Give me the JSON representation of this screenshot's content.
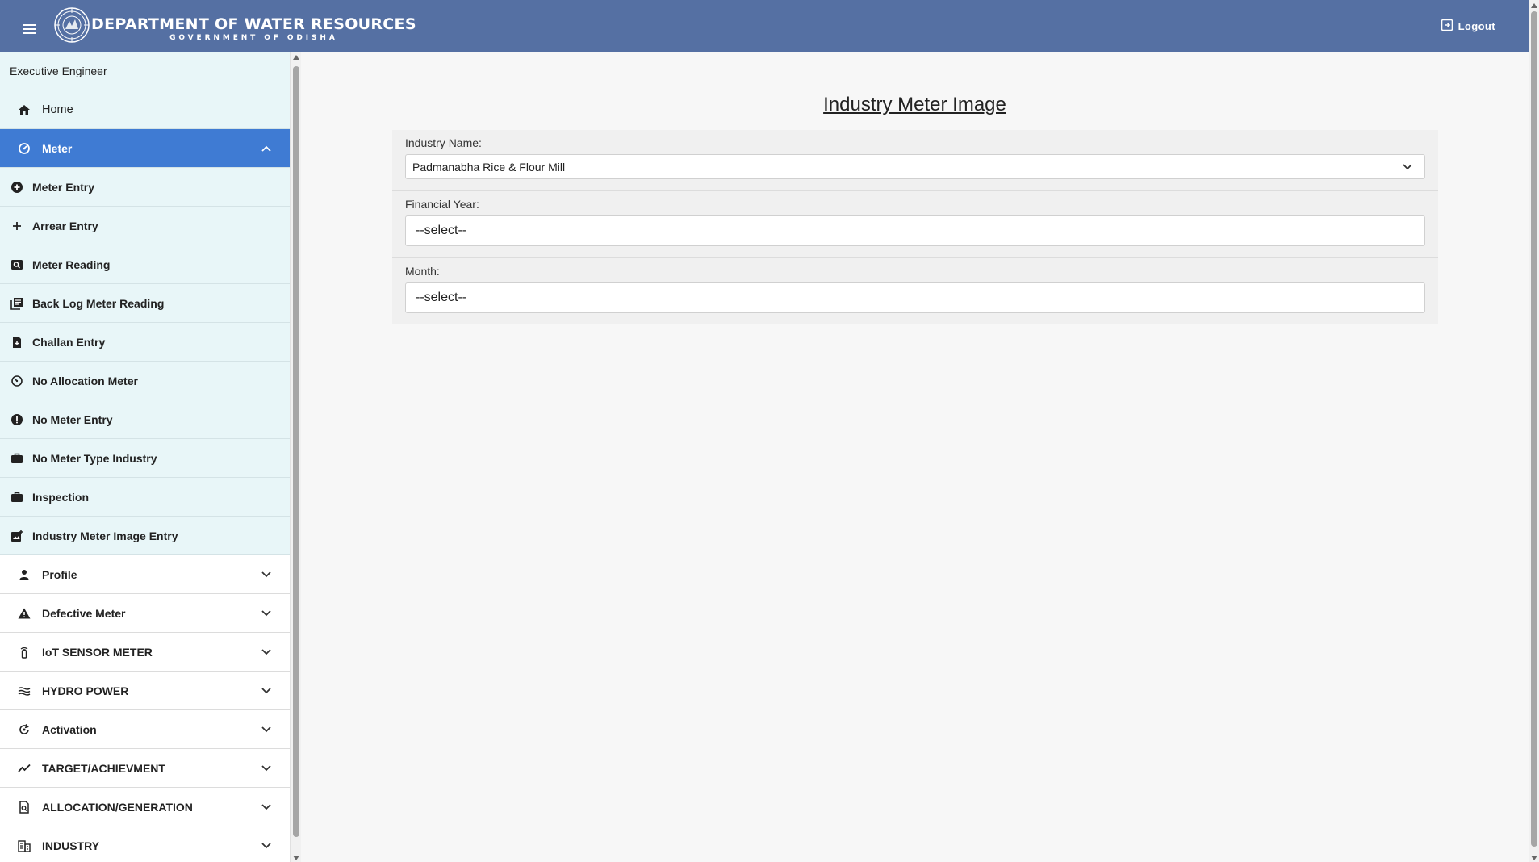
{
  "header": {
    "title": "DEPARTMENT OF WATER RESOURCES",
    "subtitle": "GOVERNMENT OF ODISHA",
    "logout_label": "Logout"
  },
  "sidebar": {
    "user_role": "Executive Engineer",
    "home_label": "Home",
    "active_section": "Meter",
    "sub_items": [
      {
        "label": "Meter Entry",
        "icon": "plus-circle-icon"
      },
      {
        "label": "Arrear Entry",
        "icon": "plus-icon"
      },
      {
        "label": "Meter Reading",
        "icon": "search-reading-icon"
      },
      {
        "label": "Back Log Meter Reading",
        "icon": "library-books-icon"
      },
      {
        "label": "Challan Entry",
        "icon": "document-add-icon"
      },
      {
        "label": "No Allocation Meter",
        "icon": "meter-off-icon"
      },
      {
        "label": "No Meter Entry",
        "icon": "exclamation-circle-icon"
      },
      {
        "label": "No Meter Type Industry",
        "icon": "briefcase-icon"
      },
      {
        "label": "Inspection",
        "icon": "briefcase-icon"
      },
      {
        "label": "Industry Meter Image Entry",
        "icon": "add-photo-icon"
      }
    ],
    "sections": [
      {
        "label": "Profile",
        "icon": "person-icon"
      },
      {
        "label": "Defective Meter",
        "icon": "warning-icon"
      },
      {
        "label": "IoT SENSOR METER",
        "icon": "sensor-icon"
      },
      {
        "label": "HYDRO POWER",
        "icon": "waves-icon"
      },
      {
        "label": "Activation",
        "icon": "refresh-icon"
      },
      {
        "label": "TARGET/ACHIEVMENT",
        "icon": "trending-icon"
      },
      {
        "label": "ALLOCATION/GENERATION",
        "icon": "document-search-icon"
      },
      {
        "label": "INDUSTRY",
        "icon": "building-icon"
      }
    ]
  },
  "main": {
    "title": "Industry Meter Image",
    "industry_label": "Industry Name:",
    "industry_value": "Padmanabha Rice & Flour Mill",
    "year_label": "Financial Year:",
    "year_value": "--select--",
    "month_label": "Month:",
    "month_value": "--select--"
  },
  "colors": {
    "header": "#5570a3",
    "active": "#3f7bd3",
    "sidebar_bg": "#e8f6f8"
  }
}
